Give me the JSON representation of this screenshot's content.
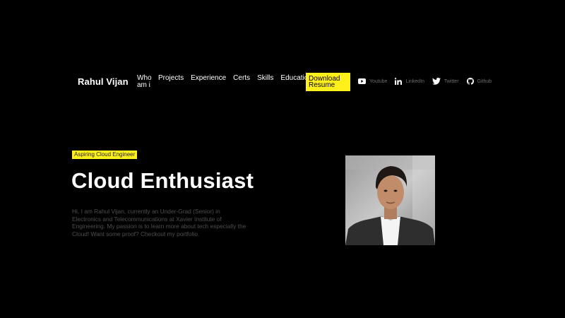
{
  "header": {
    "brand": "Rahul Vijan",
    "nav": [
      {
        "label": "Who am i"
      },
      {
        "label": "Projects"
      },
      {
        "label": "Experience"
      },
      {
        "label": "Certs"
      },
      {
        "label": "Skills"
      },
      {
        "label": "Education"
      }
    ],
    "download_label": "Download Resume",
    "socials": [
      {
        "label": "Youtube",
        "icon": "youtube-icon"
      },
      {
        "label": "LinkedIn",
        "icon": "linkedin-icon"
      },
      {
        "label": "Twitter",
        "icon": "twitter-icon"
      },
      {
        "label": "Github",
        "icon": "github-icon"
      }
    ]
  },
  "hero": {
    "tag": "Aspiring Cloud Engineer",
    "title": "Cloud Enthusiast",
    "description": "Hi, I am Rahul Vijan, currently an Under-Grad (Senior) in Electronics and Telecommunications at Xavier Institute of Engineering. My passion is to learn more about tech especially the Cloud! Want some proof? Checkout my portfolio."
  },
  "colors": {
    "background": "#000000",
    "accent": "#ffef1a",
    "text": "#ffffff",
    "muted": "#6e6e6e"
  }
}
